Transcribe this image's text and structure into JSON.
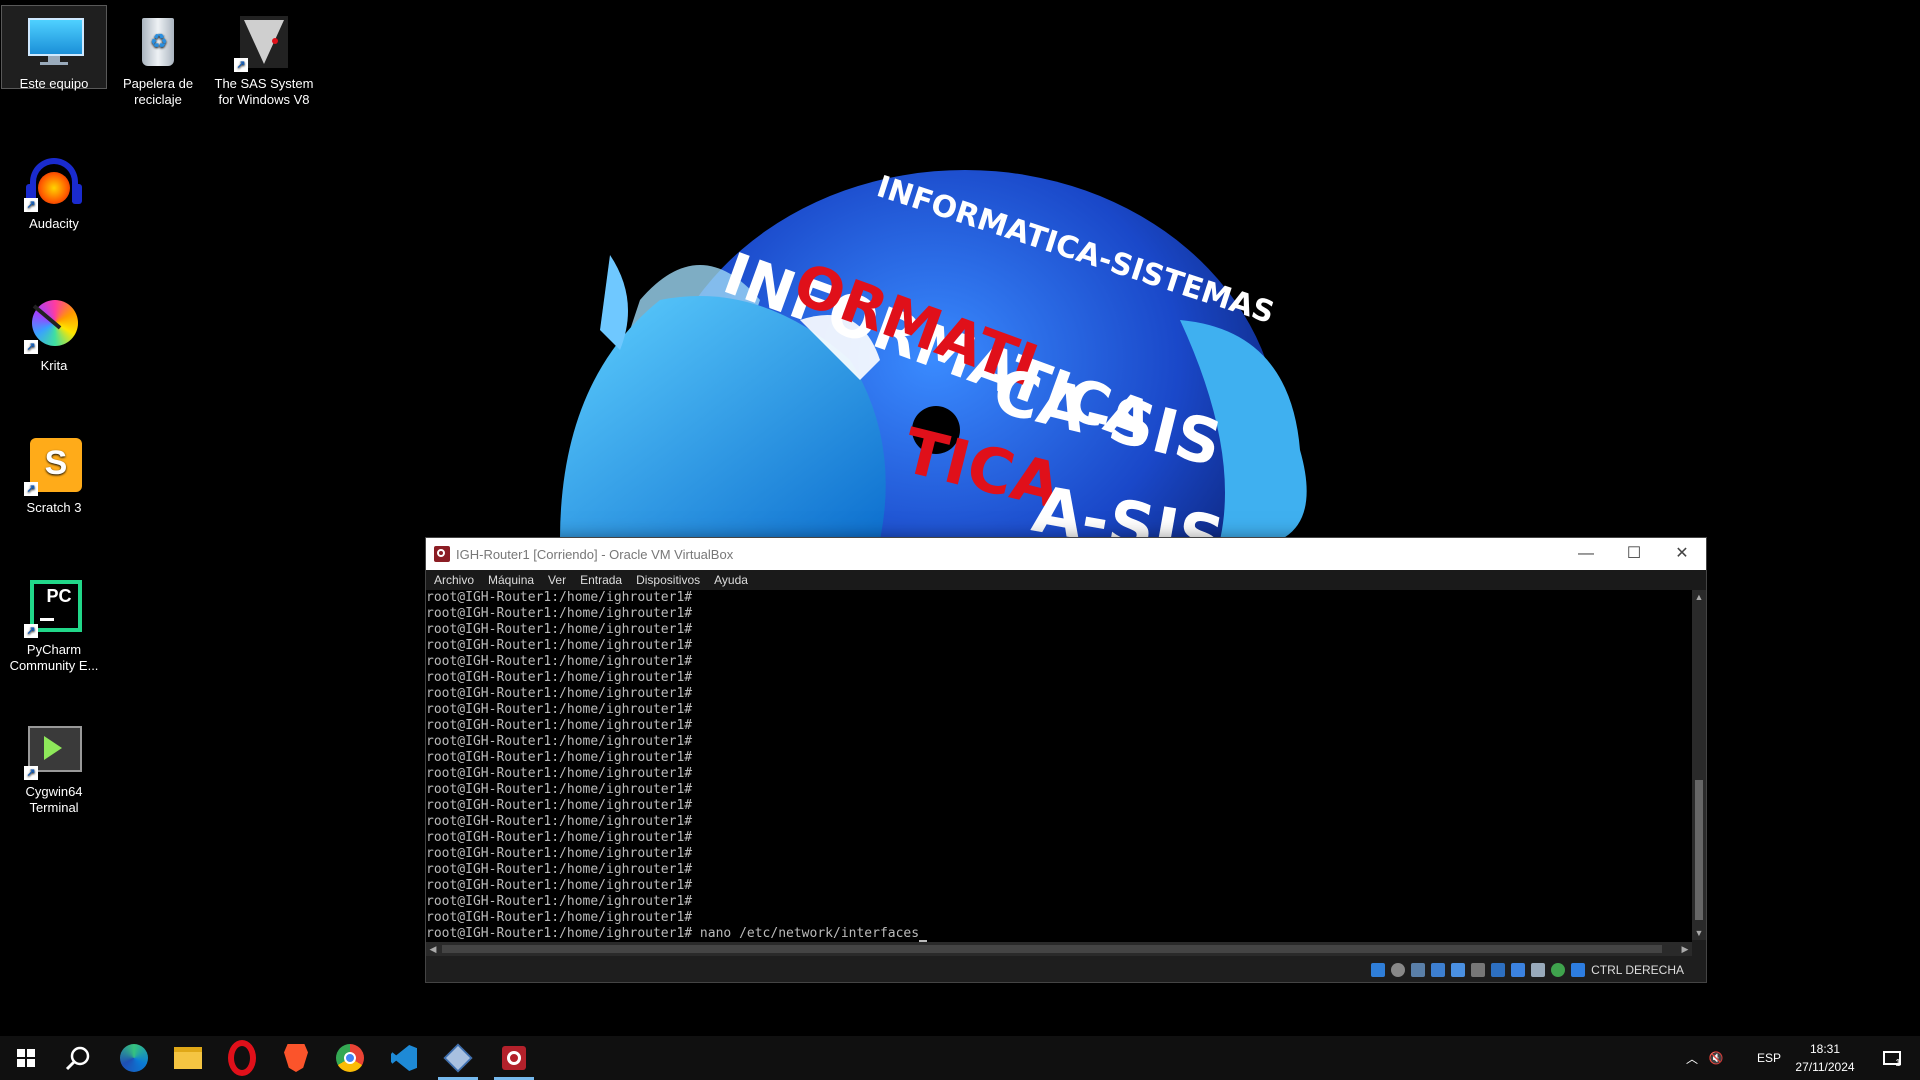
{
  "desktop": {
    "icons": [
      {
        "label": "Este equipo"
      },
      {
        "label": "Papelera de reciclaje"
      },
      {
        "label": "The SAS System for Windows V8"
      },
      {
        "label": "Audacity"
      },
      {
        "label": "Krita"
      },
      {
        "label": "Scratch 3"
      },
      {
        "label": "PyCharm Community E..."
      },
      {
        "label": "Cygwin64 Terminal"
      }
    ],
    "wallpaper_text": "INFORMATICA-SISTEMAS"
  },
  "vbox": {
    "title": "IGH-Router1 [Corriendo] - Oracle VM VirtualBox",
    "menu": [
      "Archivo",
      "Máquina",
      "Ver",
      "Entrada",
      "Dispositivos",
      "Ayuda"
    ],
    "terminal": {
      "prompt": "root@IGH-Router1:/home/ighrouter1#",
      "empty_prompt_lines": 21,
      "last_command": " nano /etc/network/interfaces"
    },
    "host_key": "CTRL DERECHA"
  },
  "taskbar": {
    "apps": [
      "start-icon",
      "search-icon",
      "edge-icon",
      "file-explorer-icon",
      "opera-icon",
      "brave-icon",
      "chrome-icon",
      "vscode-icon",
      "virtualbox-icon",
      "vm-window-icon"
    ],
    "language": "ESP",
    "time": "18:31",
    "date": "27/11/2024",
    "notifications": "1"
  },
  "colors": {
    "taskbar": "#101010",
    "accent": "#76b9ed",
    "wallpaper_blue": "#1f5fd6",
    "wallpaper_red": "#e0101a"
  }
}
